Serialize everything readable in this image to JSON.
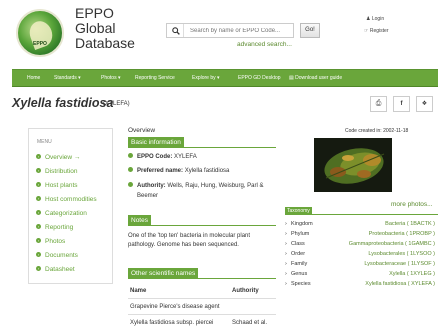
{
  "header": {
    "logo_text": "EPPO",
    "title_lines": [
      "EPPO",
      "Global",
      "Database"
    ],
    "search_placeholder": "Search by name or EPPO Code...",
    "go_label": "Go!",
    "advanced_search": "advanced search...",
    "login": "Login",
    "register": "Register"
  },
  "nav": {
    "items": [
      "Home",
      "Standards ▾",
      "Photos ▾",
      "Reporting Service",
      "Explore by ▾",
      "EPPO GD Desktop",
      "Download user guide"
    ]
  },
  "page": {
    "title": "Xylella fastidiosa",
    "code": "(XYLEFA)"
  },
  "menu": {
    "title": "MENU",
    "items": [
      "Overview →",
      "Distribution",
      "Host plants",
      "Host commodities",
      "Categorization",
      "Reporting",
      "Photos",
      "Documents",
      "Datasheet"
    ]
  },
  "overview": {
    "heading": "Overview",
    "basic_info_tab": "Basic information",
    "rows": [
      {
        "label": "EPPO Code:",
        "value": "XYLEFA"
      },
      {
        "label": "Preferred name:",
        "value": "Xylella fastidiosa"
      },
      {
        "label": "Authority:",
        "value": "Wells, Raju, Hung, Weisburg, Parl &",
        "value2": "Beemer"
      }
    ],
    "notes_tab": "Notes",
    "notes_text": "One of the 'top ten' bacteria in molecular plant pathology. Genome has been sequenced.",
    "other_names_tab": "Other scientific names",
    "table_headers": [
      "Name",
      "Authority"
    ],
    "table_rows": [
      {
        "name": "Grapevine Pierce's disease agent",
        "authority": ""
      },
      {
        "name": "Xylella fastidiosa subsp. piercei",
        "authority": "Schaad et al."
      }
    ]
  },
  "side": {
    "created": "Code created in: 2002-11-18",
    "more_photos": "more photos...",
    "taxonomy_tab": "Taxonomy",
    "taxonomy": [
      {
        "rank": "Kingdom",
        "name": "Bacteria ( 1BACTK )"
      },
      {
        "rank": "Phylum",
        "name": "Proteobacteria ( 1PROBP )"
      },
      {
        "rank": "Class",
        "name": "Gammaproteobacteria ( 1GAMBC )"
      },
      {
        "rank": "Order",
        "name": "Lysobacterales ( 1LYSOO )"
      },
      {
        "rank": "Family",
        "name": "Lysobacteraceae ( 1LYSOF )"
      },
      {
        "rank": "Genus",
        "name": "Xylella ( 1XYLEG )"
      },
      {
        "rank": "Species",
        "name": "Xylella fastidiosa ( XYLEFA )"
      }
    ]
  },
  "colors": {
    "accent": "#6aa63b",
    "link": "#5b8a2e"
  }
}
